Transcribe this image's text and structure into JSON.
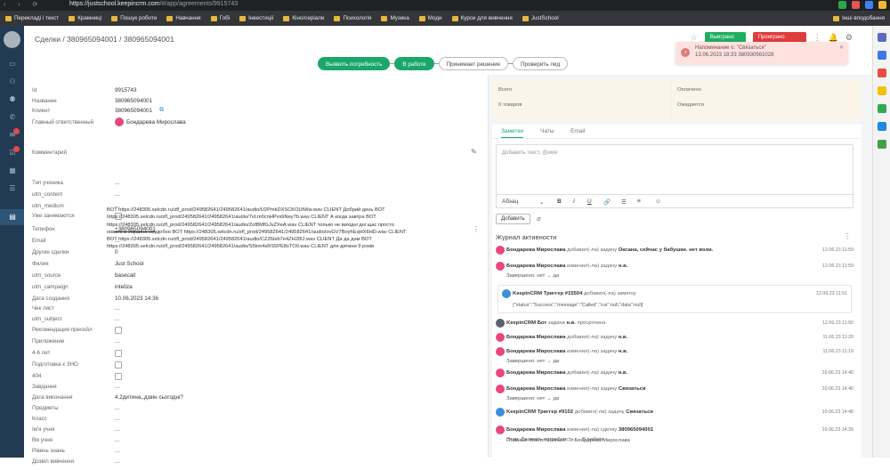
{
  "browser": {
    "url_host": "https://justschool.keepincrm.com",
    "url_path": "/#/app/agreements/9915743",
    "bookmarks": [
      "Перекладі і текст",
      "Крамниці",
      "Пошук роботи",
      "Навчання",
      "Гобі",
      "Інвестиції",
      "Кіно/серіали",
      "Психологія",
      "Музика",
      "Моди",
      "Курси для вивчення",
      "JustSchool"
    ],
    "other_bookmarks": "Інші вподобання"
  },
  "header": {
    "breadcrumb": "Сделки / 380965094001 / 380965094001",
    "btn_win": "Выиграно",
    "btn_lost": "Проиграно"
  },
  "notification": {
    "title": "Напоминание о: \"Связаться\"",
    "when": "13.06.2023 18:33 380930561028"
  },
  "stages": [
    "Выявить потребность",
    "В работе",
    "Принимает решение",
    "Проверить лид"
  ],
  "fields": [
    {
      "label": "Id",
      "value": "9915743"
    },
    {
      "label": "Название",
      "value": "380965094001"
    },
    {
      "label": "Клиент",
      "value": "380965094001"
    },
    {
      "label": "Главный ответственный",
      "value": "Бондарева Мирослава"
    },
    {
      "label": "Комментарий",
      "value": ""
    },
    {
      "label": "Тип ученика",
      "value": "..."
    },
    {
      "label": "utm_content",
      "value": "..."
    },
    {
      "label": "utm_medium",
      "value": "..."
    },
    {
      "label": "Уже занимаются",
      "value": ""
    },
    {
      "label": "Телефон",
      "value": "+380965094001"
    },
    {
      "label": "Email",
      "value": "..."
    },
    {
      "label": "Другие сделки",
      "value": "0"
    },
    {
      "label": "Филия",
      "value": "Just School"
    },
    {
      "label": "utm_source",
      "value": "basecall"
    },
    {
      "label": "utm_campaign",
      "value": "inteliza"
    },
    {
      "label": "Дата создания",
      "value": "10.06.2023 14:36"
    },
    {
      "label": "Чек лист",
      "value": "..."
    },
    {
      "label": "utm_subject",
      "value": "..."
    },
    {
      "label": "Рекомендация пресейл",
      "value": ""
    },
    {
      "label": "Приложение",
      "value": "..."
    },
    {
      "label": "4-6 лет",
      "value": ""
    },
    {
      "label": "Подготовка к ЗНО",
      "value": ""
    },
    {
      "label": "404",
      "value": ""
    },
    {
      "label": "Завдання",
      "value": "..."
    },
    {
      "label": "Дата виконання",
      "value": "4.2дитина,,дзвін сьогодні?"
    },
    {
      "label": "Предметы",
      "value": "..."
    },
    {
      "label": "Класс",
      "value": "..."
    },
    {
      "label": "Ім'я учня",
      "value": "..."
    },
    {
      "label": "Вік учня",
      "value": "..."
    },
    {
      "label": "Рівень знань",
      "value": "..."
    },
    {
      "label": "Дозвіл вивчення",
      "value": "..."
    }
  ],
  "comment_lines": [
    "BOT https://248305.selcdn.ru/zfl_prod/249582641/249582641/audio/U2PmkDXSCKOUtWw.wav                                         CLIENT Добрий день  BOT",
    "https://248305.selcdn.ru/zfl_prod/249582641/249582641/audio/7vLm0cnHPvxbNey7b.wav                                   CLIENT А когда завтра  BOT",
    "https://248305.selcdn.ru/zfl_prod/249582641/249582641/audio/Zof8MfGJvZXeA.wav                           CLIENT только не вихідні дні щас просто",
    "нового в Украине неудобно  BOT https://248305.selcdn.ru/zfl_prod/249582641/249582641/audio/ovGV7BoyhEqHX6HD.wav                              CLIENT",
    "BOT https://248305.selcdn.ru/zfl_prod/249582641/249582641/audio/CZZ6ieb7e4ZH28IJ.wav                         CLIENT Да да дам  BOT",
    "https://248305.selcdn.ru/zfl_prod/249582641/249582641/audio/S5km4sRS5PE8sTO0.wav                                 CLIENT для дитини 9 років"
  ],
  "totals": {
    "total_label": "Всего",
    "total_goods": "0 товаров",
    "paid_label": "Оплачено",
    "expected_label": "Ожидается"
  },
  "notes": {
    "tabs": [
      "Заметки",
      "Чаты",
      "Email"
    ],
    "placeholder": "Добавить текст, @имя",
    "paragraph": "Абзац",
    "add_button": "Добавить"
  },
  "journal": {
    "title": "Журнал активности",
    "entries": [
      {
        "author": "Бондарева Мирослава",
        "action": "добавил(-ла) задачу",
        "obj": "Оксана, сейчас у бабушки. нет возм.",
        "date": "12.06.23 11:59",
        "sub": ""
      },
      {
        "author": "Бондарева Мирослава",
        "action": "изменил(-ла) задачу",
        "obj": "н.в.",
        "date": "12.06.23 11:59",
        "sub": "Завершено: нет  →  да"
      },
      {
        "author": "KeepinCRM Триггер #15504",
        "action": "добавил(-ла) заметку",
        "obj": "",
        "date": "12.06.23 11:51",
        "sub": "{\"status\":\"Success\",\"message\":\"Called\",\"rus\":null,\"data\":null}"
      },
      {
        "author": "KeepinCRM Бот",
        "action": "задача",
        "obj": "н.в.",
        "tail": "просрочена",
        "date": "12.06.23 11:50",
        "sub": ""
      },
      {
        "author": "Бондарева Мирослава",
        "action": "добавил(-ла) задачу",
        "obj": "н.в.",
        "date": "11.06.23 11:20",
        "sub": ""
      },
      {
        "author": "Бондарева Мирослава",
        "action": "изменил(-ла) задачу",
        "obj": "н.в.",
        "date": "11.06.23 11:19",
        "sub": "Завершено: нет  →  да"
      },
      {
        "author": "Бондарева Мирослава",
        "action": "добавил(-ла) задачу",
        "obj": "н.в.",
        "date": "10.06.23 14:40",
        "sub": ""
      },
      {
        "author": "Бондарева Мирослава",
        "action": "изменил(-ла) задачу",
        "obj": "Связаться",
        "date": "10.06.23 14:40",
        "sub": "Завершено: нет  →  да"
      },
      {
        "author": "KeepinCRM Триггер #9102",
        "action": "добавил(-ла) задачу",
        "obj": "Связаться",
        "date": "10.06.23 14:40",
        "sub": ""
      },
      {
        "author": "Бондарева Мирослава",
        "action": "изменил(-ла) сделку",
        "obj": "380965094001",
        "date": "10.06.23 14:39",
        "sub": "Этап: Выявить потребность  →  В работе"
      },
      {
        "author": "",
        "action": "",
        "obj": "",
        "date": "",
        "sub": "Главный ответственный:  →  Бондарева Мирослава"
      }
    ]
  }
}
